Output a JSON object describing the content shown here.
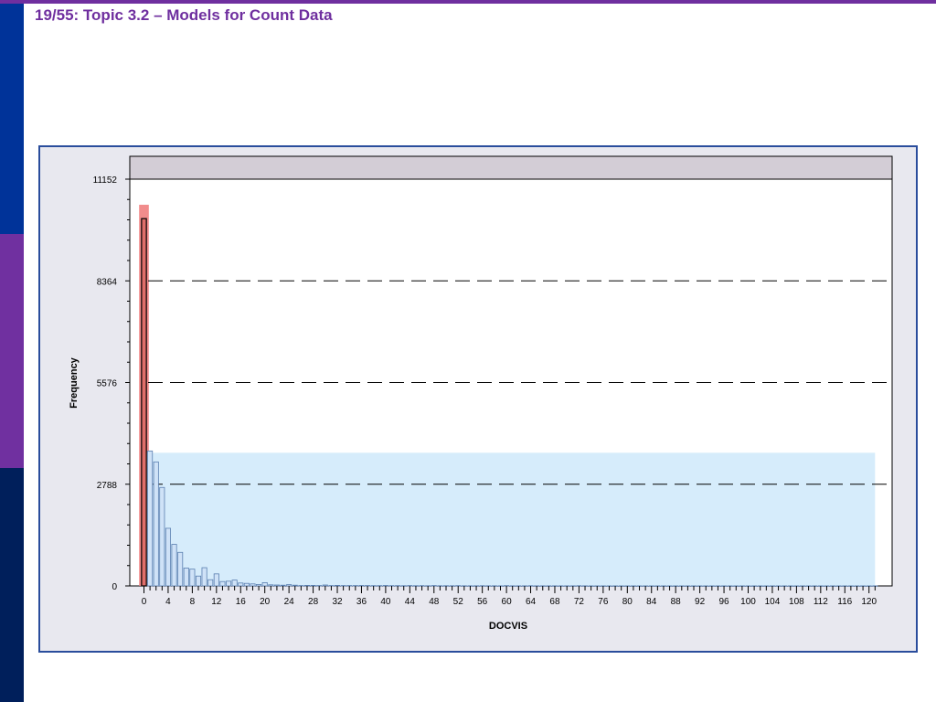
{
  "slide": {
    "title": "19/55: Topic 3.2 – Models for Count Data"
  },
  "colors": {
    "accent": "#6f2f9f",
    "selection_red": "#f08080",
    "selection_blue": "#d6ecfb",
    "bar_fill": "#cfe2f7",
    "bar_stroke": "#5a7fb0"
  },
  "chart_data": {
    "type": "bar",
    "xlabel": "DOCVIS",
    "ylabel": "Frequency",
    "xlim": [
      0,
      121
    ],
    "ylim": [
      0,
      11152
    ],
    "yticks": [
      0,
      2788,
      5576,
      8364,
      11152
    ],
    "xticks": [
      0,
      4,
      8,
      12,
      16,
      20,
      24,
      28,
      32,
      36,
      40,
      44,
      48,
      52,
      56,
      60,
      64,
      68,
      72,
      76,
      80,
      84,
      88,
      92,
      96,
      100,
      104,
      108,
      112,
      116,
      120
    ],
    "grid": "dashed horizontal at y ticks",
    "highlight": {
      "red_region": {
        "x_from": -0.5,
        "x_to": 0.5,
        "y_top": 10450
      },
      "blue_region": {
        "x_from": 0.5,
        "x_to": 121,
        "y_top": 3650
      }
    },
    "x": [
      0,
      1,
      2,
      3,
      4,
      5,
      6,
      7,
      8,
      9,
      10,
      11,
      12,
      13,
      14,
      15,
      16,
      17,
      18,
      19,
      20,
      21,
      22,
      23,
      24,
      25,
      26,
      27,
      28,
      29,
      30,
      31,
      32,
      33,
      34,
      35,
      36,
      37,
      38,
      39,
      40,
      41,
      42,
      43,
      44,
      45,
      46,
      47,
      48,
      49,
      50,
      51,
      52,
      53,
      54,
      55,
      56,
      57,
      58,
      59,
      60,
      61,
      62,
      63,
      64,
      65,
      66,
      67,
      68,
      69,
      70,
      71,
      72,
      73,
      74,
      75,
      76,
      77,
      78,
      79,
      80,
      81,
      82,
      83,
      84,
      85,
      86,
      87,
      88,
      89,
      90,
      91,
      92,
      93,
      94,
      95,
      96,
      97,
      98,
      99,
      100,
      101,
      102,
      103,
      104,
      105,
      106,
      107,
      108,
      109,
      110,
      111,
      112,
      113,
      114,
      115,
      116,
      117,
      118,
      119,
      120,
      121
    ],
    "values": [
      10070,
      3700,
      3400,
      2700,
      1580,
      1140,
      920,
      490,
      460,
      270,
      500,
      170,
      330,
      120,
      130,
      160,
      80,
      70,
      55,
      40,
      90,
      30,
      25,
      20,
      35,
      20,
      10,
      15,
      15,
      10,
      25,
      10,
      15,
      10,
      10,
      10,
      12,
      10,
      8,
      8,
      12,
      8,
      8,
      6,
      10,
      6,
      8,
      5,
      10,
      5,
      6,
      5,
      8,
      4,
      4,
      4,
      6,
      4,
      4,
      3,
      8,
      3,
      3,
      3,
      6,
      3,
      3,
      3,
      3,
      3,
      3,
      3,
      6,
      3,
      2,
      2,
      2,
      2,
      2,
      2,
      2,
      2,
      2,
      2,
      2,
      2,
      2,
      2,
      2,
      2,
      2,
      2,
      2,
      2,
      2,
      2,
      2,
      2,
      2,
      2,
      2,
      2,
      2,
      2,
      2,
      2,
      2,
      2,
      2,
      2,
      2,
      2,
      2,
      2,
      2,
      2,
      2,
      2,
      2,
      2,
      2,
      3
    ]
  }
}
